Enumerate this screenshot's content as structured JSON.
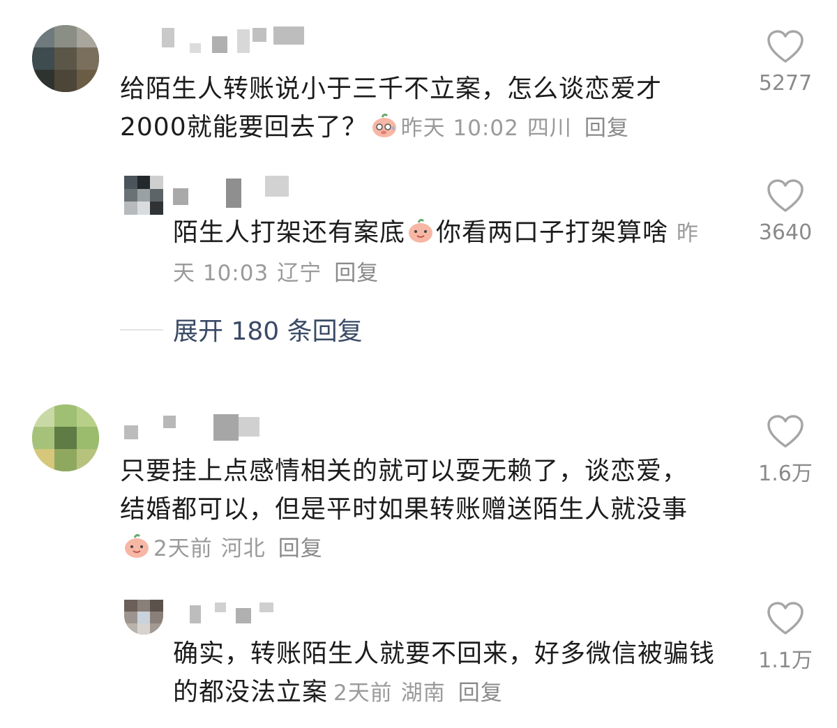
{
  "comments": [
    {
      "text": "给陌生人转账说小于三千不立案，怎么谈恋爱才2000就能要回去了？",
      "time": "昨天 10:02",
      "location": "四川",
      "reply_label": "回复",
      "likes": "5277",
      "emoji": "sweat-pig-emoji",
      "replies": [
        {
          "text": "陌生人打架还有案底",
          "text_after": "你看两口子打架算啥",
          "time": "昨天 10:03",
          "location": "辽宁",
          "reply_label": "回复",
          "likes": "3640",
          "emoji": "smile-pig-emoji"
        }
      ],
      "expand_label": "展开 180 条回复"
    },
    {
      "text": "只要挂上点感情相关的就可以耍无赖了，谈恋爱，结婚都可以，但是平时如果转账赠送陌生人就没事",
      "time": "2天前",
      "location": "河北",
      "reply_label": "回复",
      "likes": "1.6万",
      "emoji": "smile-pig-emoji",
      "replies": [
        {
          "text": "确实，转账陌生人就要不回来，好多微信被骗钱的都没法立案",
          "time": "2天前",
          "location": "湖南",
          "reply_label": "回复",
          "likes": "1.1万"
        }
      ]
    }
  ],
  "colors": {
    "text": "#1c1c1c",
    "meta": "#9a9a9a",
    "expand": "#3a4a66",
    "emoji": "#f7b7a5"
  }
}
